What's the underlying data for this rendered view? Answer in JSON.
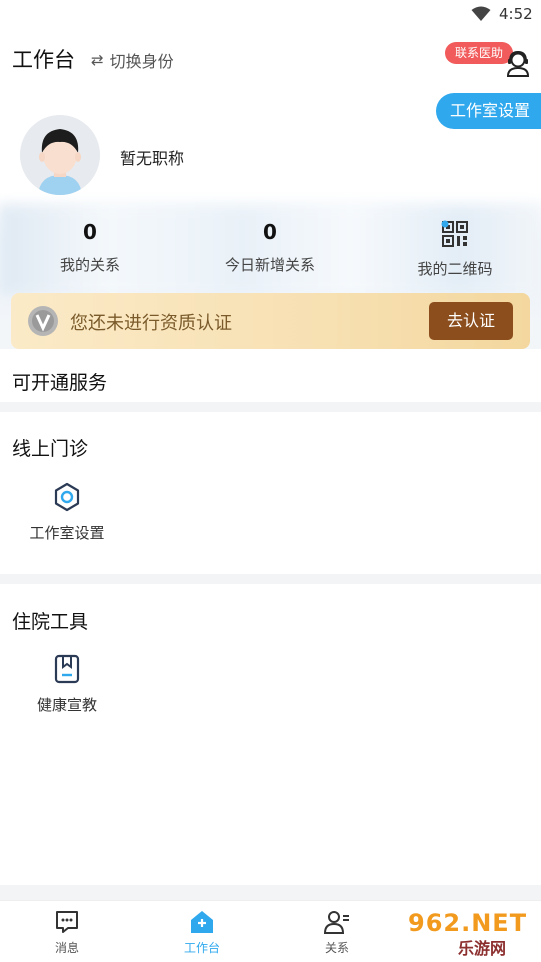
{
  "status_bar": {
    "time": "4:52"
  },
  "header": {
    "title": "工作台",
    "switch_label": "切换身份",
    "contact_badge": "联系医助"
  },
  "studio_settings_button": "工作室设置",
  "profile": {
    "job_title": "暂无职称"
  },
  "stats": [
    {
      "value": "0",
      "label": "我的关系"
    },
    {
      "value": "0",
      "label": "今日新增关系"
    },
    {
      "label": "我的二维码"
    }
  ],
  "certification": {
    "text": "您还未进行资质认证",
    "button": "去认证"
  },
  "sections": {
    "available_services": {
      "title": "可开通服务"
    },
    "online_clinic": {
      "title": "线上门诊",
      "items": [
        {
          "label": "工作室设置",
          "icon": "gear-icon"
        }
      ]
    },
    "inpatient_tools": {
      "title": "住院工具",
      "items": [
        {
          "label": "健康宣教",
          "icon": "bookmark-icon"
        }
      ]
    }
  },
  "tab_bar": {
    "tabs": [
      {
        "label": "消息",
        "icon": "message-icon"
      },
      {
        "label": "工作台",
        "icon": "home-icon",
        "active": true
      },
      {
        "label": "关系",
        "icon": "contacts-icon"
      }
    ]
  },
  "watermark": {
    "top": "962.NET",
    "bottom": "乐游网"
  },
  "colors": {
    "accent": "#2fa8ee",
    "badge": "#f25b5b",
    "cert_button": "#8b4e1c"
  }
}
